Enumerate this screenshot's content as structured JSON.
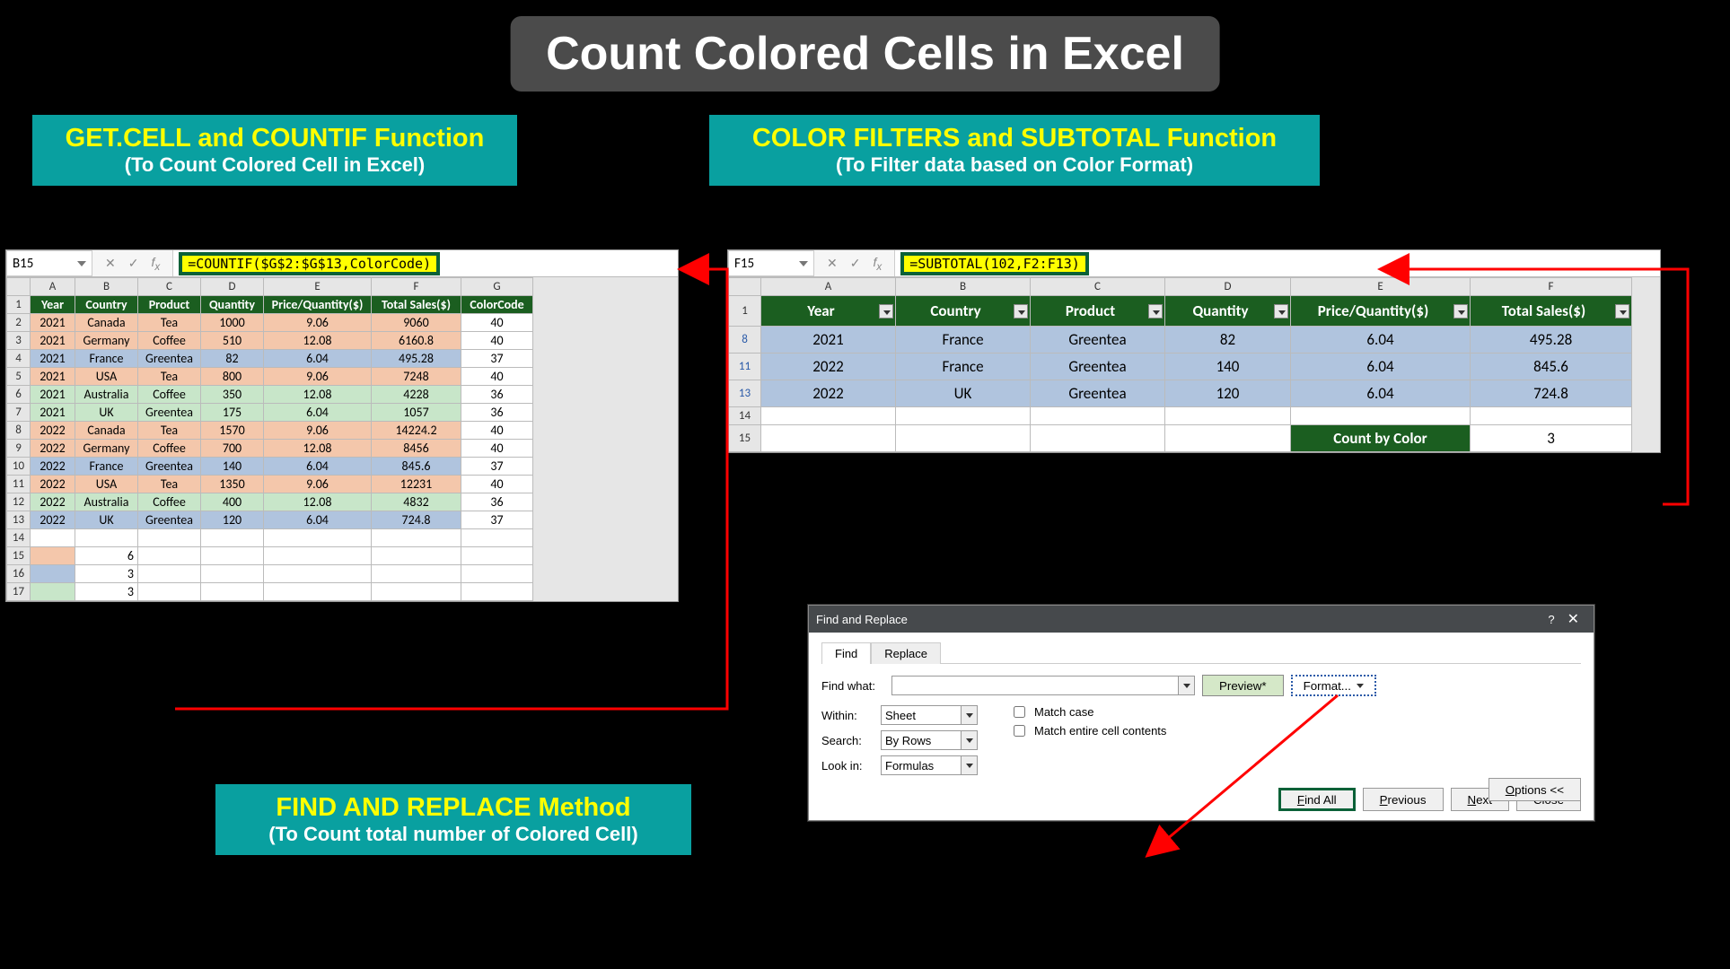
{
  "title": "Count Colored Cells in Excel",
  "labels": {
    "left": {
      "head": "GET.CELL and COUNTIF Function",
      "sub": "(To Count Colored Cell in Excel)"
    },
    "right": {
      "head": "COLOR FILTERS and SUBTOTAL Function",
      "sub": "(To Filter data based on Color Format)"
    },
    "bottom": {
      "head": "FIND AND REPLACE Method",
      "sub": "(To Count total number of Colored Cell)"
    }
  },
  "left_sheet": {
    "namebox": "B15",
    "formula": "=COUNTIF($G$2:$G$13,ColorCode)",
    "cols": [
      "A",
      "B",
      "C",
      "D",
      "E",
      "F",
      "G"
    ],
    "headers": [
      "Year",
      "Country",
      "Product",
      "Quantity",
      "Price/Quantity($)",
      "Total Sales($)",
      "ColorCode"
    ],
    "rows": [
      {
        "n": 2,
        "c": "peach",
        "d": [
          "2021",
          "Canada",
          "Tea",
          "1000",
          "9.06",
          "9060",
          "40"
        ]
      },
      {
        "n": 3,
        "c": "peach",
        "d": [
          "2021",
          "Germany",
          "Coffee",
          "510",
          "12.08",
          "6160.8",
          "40"
        ]
      },
      {
        "n": 4,
        "c": "blue",
        "d": [
          "2021",
          "France",
          "Greentea",
          "82",
          "6.04",
          "495.28",
          "37"
        ]
      },
      {
        "n": 5,
        "c": "peach",
        "d": [
          "2021",
          "USA",
          "Tea",
          "800",
          "9.06",
          "7248",
          "40"
        ]
      },
      {
        "n": 6,
        "c": "green",
        "d": [
          "2021",
          "Australia",
          "Coffee",
          "350",
          "12.08",
          "4228",
          "36"
        ]
      },
      {
        "n": 7,
        "c": "green",
        "d": [
          "2021",
          "UK",
          "Greentea",
          "175",
          "6.04",
          "1057",
          "36"
        ]
      },
      {
        "n": 8,
        "c": "peach",
        "d": [
          "2022",
          "Canada",
          "Tea",
          "1570",
          "9.06",
          "14224.2",
          "40"
        ]
      },
      {
        "n": 9,
        "c": "peach",
        "d": [
          "2022",
          "Germany",
          "Coffee",
          "700",
          "12.08",
          "8456",
          "40"
        ]
      },
      {
        "n": 10,
        "c": "blue",
        "d": [
          "2022",
          "France",
          "Greentea",
          "140",
          "6.04",
          "845.6",
          "37"
        ]
      },
      {
        "n": 11,
        "c": "peach",
        "d": [
          "2022",
          "USA",
          "Tea",
          "1350",
          "9.06",
          "12231",
          "40"
        ]
      },
      {
        "n": 12,
        "c": "green",
        "d": [
          "2022",
          "Australia",
          "Coffee",
          "400",
          "12.08",
          "4832",
          "36"
        ]
      },
      {
        "n": 13,
        "c": "blue",
        "d": [
          "2022",
          "UK",
          "Greentea",
          "120",
          "6.04",
          "724.8",
          "37"
        ]
      }
    ],
    "results": [
      {
        "n": 15,
        "b": "6",
        "a_color": "peach"
      },
      {
        "n": 16,
        "b": "3",
        "a_color": "blue"
      },
      {
        "n": 17,
        "b": "3",
        "a_color": "green"
      }
    ]
  },
  "right_sheet": {
    "namebox": "F15",
    "formula": "=SUBTOTAL(102,F2:F13)",
    "cols": [
      "A",
      "B",
      "C",
      "D",
      "E",
      "F"
    ],
    "headers": [
      "Year",
      "Country",
      "Product",
      "Quantity",
      "Price/Quantity($)",
      "Total Sales($)"
    ],
    "rows": [
      {
        "n": 8,
        "d": [
          "2021",
          "France",
          "Greentea",
          "82",
          "6.04",
          "495.28"
        ]
      },
      {
        "n": 11,
        "d": [
          "2022",
          "France",
          "Greentea",
          "140",
          "6.04",
          "845.6"
        ]
      },
      {
        "n": 13,
        "d": [
          "2022",
          "UK",
          "Greentea",
          "120",
          "6.04",
          "724.8"
        ]
      }
    ],
    "count_label": "Count by Color",
    "count_value": "3"
  },
  "dialog": {
    "title": "Find and Replace",
    "tab_find": "Find",
    "tab_replace": "Replace",
    "find_what_lbl": "Find what:",
    "preview": "Preview*",
    "format": "Format...",
    "within_lbl": "Within:",
    "within_val": "Sheet",
    "search_lbl": "Search:",
    "search_val": "By Rows",
    "lookin_lbl": "Look in:",
    "lookin_val": "Formulas",
    "match_case": "Match case",
    "match_entire": "Match entire cell contents",
    "options": "Options <<",
    "find_all": "Find All",
    "previous": "Previous",
    "next": "Next",
    "close": "Close"
  }
}
